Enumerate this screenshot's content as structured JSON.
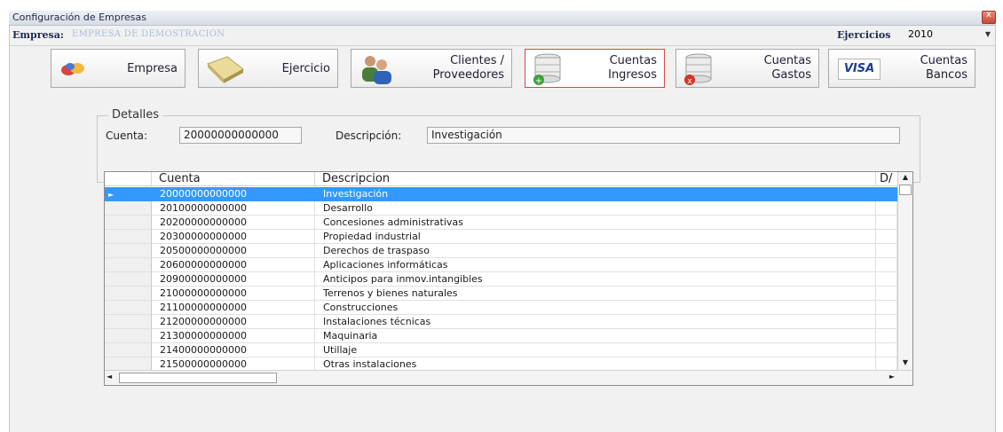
{
  "window": {
    "title": "Configuración de Empresas"
  },
  "header": {
    "empresa_label": "Empresa:",
    "empresa_value": "EMPRESA DE DEMOSTRACION",
    "ejercicios_label": "Ejercicios",
    "ejercicios_value": "2010"
  },
  "toolbar": {
    "empresa": "Empresa",
    "ejercicio": "Ejercicio",
    "clientes_line1": "Clientes /",
    "clientes_line2": "Proveedores",
    "ingresos_line1": "Cuentas",
    "ingresos_line2": "Ingresos",
    "gastos_line1": "Cuentas",
    "gastos_line2": "Gastos",
    "bancos_line1": "Cuentas",
    "bancos_line2": "Bancos",
    "visa_text": "VISA",
    "active": "ingresos"
  },
  "detalles": {
    "legend": "Detalles",
    "cuenta_label": "Cuenta:",
    "cuenta_value": "20000000000000",
    "descripcion_label": "Descripción:",
    "descripcion_value": "Investigación"
  },
  "grid": {
    "columns": [
      "Cuenta",
      "Descripcion",
      "D/"
    ],
    "rows": [
      {
        "cuenta": "20000000000000",
        "descripcion": "Investigación"
      },
      {
        "cuenta": "20100000000000",
        "descripcion": "Desarrollo"
      },
      {
        "cuenta": "20200000000000",
        "descripcion": "Concesiones administrativas"
      },
      {
        "cuenta": "20300000000000",
        "descripcion": "Propiedad industrial"
      },
      {
        "cuenta": "20500000000000",
        "descripcion": "Derechos de traspaso"
      },
      {
        "cuenta": "20600000000000",
        "descripcion": "Aplicaciones informáticas"
      },
      {
        "cuenta": "20900000000000",
        "descripcion": "Anticipos para inmov.intangibles"
      },
      {
        "cuenta": "21000000000000",
        "descripcion": "Terrenos y bienes naturales"
      },
      {
        "cuenta": "21100000000000",
        "descripcion": "Construcciones"
      },
      {
        "cuenta": "21200000000000",
        "descripcion": "Instalaciones técnicas"
      },
      {
        "cuenta": "21300000000000",
        "descripcion": "Maquinaria"
      },
      {
        "cuenta": "21400000000000",
        "descripcion": "Utillaje"
      },
      {
        "cuenta": "21500000000000",
        "descripcion": "Otras instalaciones"
      }
    ],
    "selected_row": 0
  },
  "colors": {
    "selection": "#3399ff",
    "active_border": "#d54848"
  }
}
